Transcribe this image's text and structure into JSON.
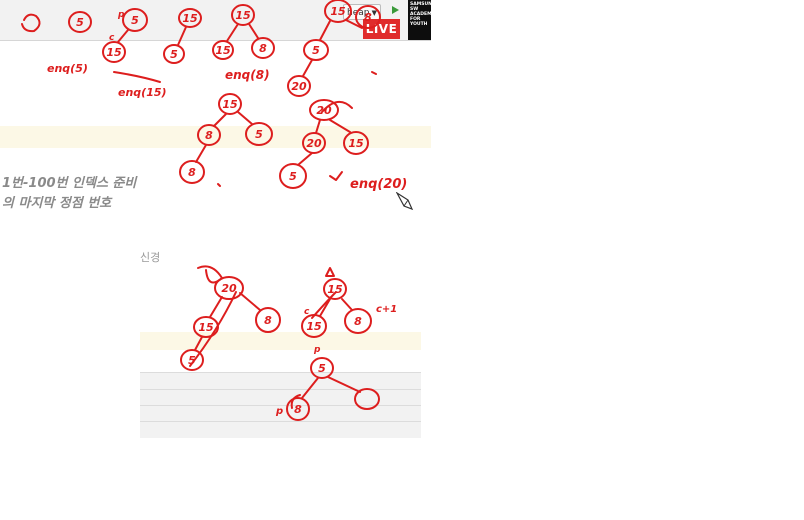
{
  "toolbar": {
    "heap_select_value": "heap",
    "live_label": "LIVE",
    "logo_text": "SAMSUNG\nSW\nACADEMY\nFOR\nYOUTH"
  },
  "lecture": {
    "line_1": "1번-100번 인덱스 준비",
    "line_2": "의 마지막 정점 번호",
    "partial_word": "신경"
  },
  "annotations": {
    "node_labels": [
      "5",
      "5",
      "15",
      "15",
      "5",
      "15",
      "15",
      "8",
      "15",
      "5",
      "8",
      "20",
      "15",
      "20",
      "8",
      "5",
      "20",
      "15",
      "8",
      "5",
      "20",
      "15",
      "8",
      "5",
      "15",
      "8",
      "15",
      "5",
      "8"
    ],
    "enq_labels": [
      "enq(5)",
      "enq(15)",
      "enq(8)",
      "enq(20)"
    ],
    "letter_p": "p",
    "letter_c": "c",
    "c_plus_1": "c+1",
    "ink_color": "#dd1e1e"
  }
}
